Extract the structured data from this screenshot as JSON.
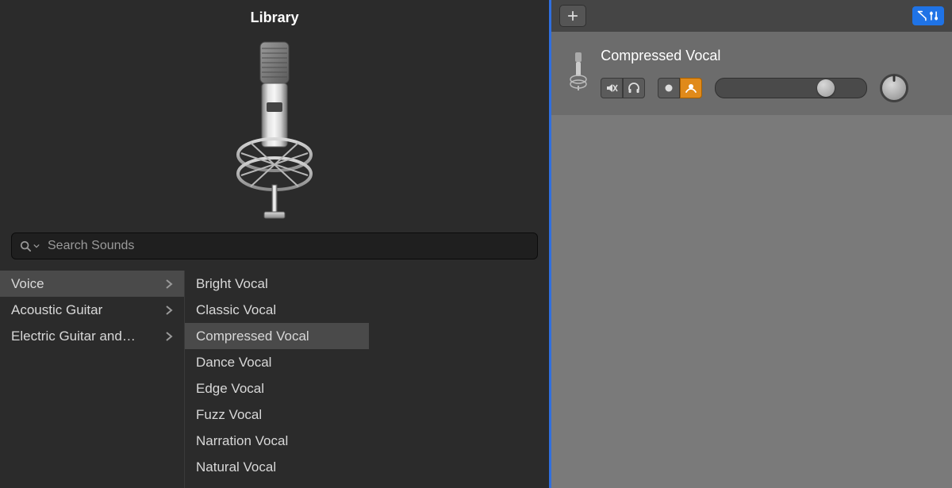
{
  "library": {
    "title": "Library",
    "search_placeholder": "Search Sounds",
    "preview_icon": "microphone-icon",
    "categories": [
      {
        "label": "Voice",
        "has_children": true,
        "selected": true
      },
      {
        "label": "Acoustic Guitar",
        "has_children": true,
        "selected": false
      },
      {
        "label": "Electric Guitar and…",
        "has_children": true,
        "selected": false
      }
    ],
    "presets": [
      {
        "label": "Bright Vocal",
        "selected": false
      },
      {
        "label": "Classic Vocal",
        "selected": false
      },
      {
        "label": "Compressed Vocal",
        "selected": true
      },
      {
        "label": "Dance Vocal",
        "selected": false
      },
      {
        "label": "Edge Vocal",
        "selected": false
      },
      {
        "label": "Fuzz Vocal",
        "selected": false
      },
      {
        "label": "Narration Vocal",
        "selected": false
      },
      {
        "label": "Natural Vocal",
        "selected": false
      }
    ]
  },
  "tracks": {
    "add_button": "plus-icon",
    "filter_button": "automation-filter-icon",
    "track": {
      "name": "Compressed Vocal",
      "thumb_icon": "microphone-icon",
      "controls": {
        "mute": {
          "active": false,
          "icon": "mute-icon"
        },
        "monitor": {
          "active": false,
          "icon": "headphones-icon"
        },
        "record": {
          "active": false,
          "icon": "record-dot-icon"
        },
        "input": {
          "active": true,
          "icon": "input-monitor-icon"
        },
        "volume": {
          "min": 0,
          "max": 100,
          "value": 70
        },
        "pan": {
          "min": -64,
          "max": 64,
          "value": 0
        }
      }
    }
  },
  "colors": {
    "accent_blue": "#1f73e6",
    "accent_orange": "#e08a1a",
    "bg_dark": "#2b2b2b",
    "bg_track_panel": "#7a7a7a"
  }
}
